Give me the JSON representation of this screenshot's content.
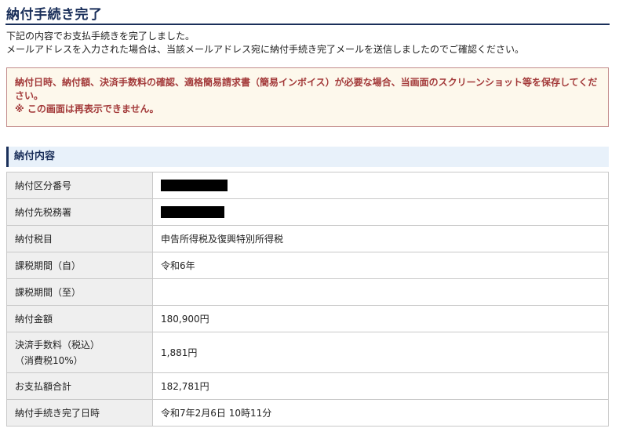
{
  "page": {
    "title": "納付手続き完了"
  },
  "intro": {
    "line1": "下記の内容でお支払手続きを完了しました。",
    "line2": "メールアドレスを入力された場合は、当該メールアドレス宛に納付手続き完了メールを送信しましたのでご確認ください。"
  },
  "notice": {
    "text": "納付日時、納付額、決済手数料の確認、適格簡易請求書（簡易インボイス）が必要な場合、当画面のスクリーンショット等を保存してください。",
    "warning": "※ この画面は再表示できません。"
  },
  "section": {
    "title": "納付内容"
  },
  "table": {
    "rows": [
      {
        "label": "納付区分番号",
        "value": "",
        "redacted": true
      },
      {
        "label": "納付先税務署",
        "value": "",
        "redacted": true
      },
      {
        "label": "納付税目",
        "value": "申告所得税及復興特別所得税"
      },
      {
        "label": "課税期間（自）",
        "value": "令和6年"
      },
      {
        "label": "課税期間（至）",
        "value": ""
      },
      {
        "label": "納付金額",
        "value": "180,900円"
      },
      {
        "label": "決済手数料（税込）",
        "label2": "（消費税10%）",
        "value": "1,881円"
      },
      {
        "label": "お支払額合計",
        "value": "182,781円"
      },
      {
        "label": "納付手続き完了日時",
        "value": "令和7年2月6日 10時11分"
      }
    ]
  },
  "colors": {
    "title": "#1a2f5a",
    "notice_text": "#a33a3a",
    "notice_border": "#c28a8a",
    "notice_bg": "#fdf8ec",
    "section_bg": "#e8f1fa",
    "label_bg": "#efefef"
  }
}
